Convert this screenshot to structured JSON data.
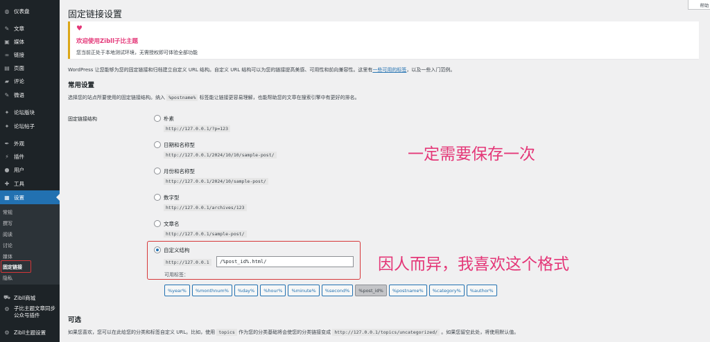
{
  "sidebar": {
    "dashboard": "仪表盘",
    "posts": "文章",
    "media": "媒体",
    "links": "链接",
    "pages": "页面",
    "comments": "评论",
    "tweets": "微语",
    "forum_board": "论坛版块",
    "forum_posts": "论坛帖子",
    "appearance": "外观",
    "plugins": "插件",
    "users": "用户",
    "tools": "工具",
    "settings": "设置",
    "submenu": [
      "常规",
      "撰写",
      "阅读",
      "讨论",
      "媒体",
      "固定链接",
      "隐私"
    ],
    "zibll_mall": "Zibll商城",
    "sync_plugin": "子比主题文章同步公众号插件",
    "zibll_theme_settings": "Zibll主题设置"
  },
  "help_button": "帮助",
  "page_title": "固定链接设置",
  "notice": {
    "title": "欢迎使用Zibll子比主题",
    "text": "您当前正处于本地测试环境，无需授权即可体验全部功能"
  },
  "intro": {
    "text_before": "WordPress 让您能够为您的固定链接和归档建立自定义 URL 结构。自定义 URL 结构可以为您的链接提高美感、可用性和前向兼容性。这里有",
    "link": "一些可用的标签",
    "text_after": "，以及一些入门范例。"
  },
  "common": {
    "heading": "常用设置",
    "desc_before": "选择您的站点所要使用的固定链接结构。纳入",
    "desc_code": "%postname%",
    "desc_after": "标签能让链接更容易理解，也能帮助您的文章在搜索引擎中有更好的排名。"
  },
  "permalink_label": "固定链接结构",
  "options": [
    {
      "label": "朴素",
      "example": "http://127.0.0.1/?p=123",
      "checked": false
    },
    {
      "label": "日期和名称型",
      "example": "http://127.0.0.1/2024/10/10/sample-post/",
      "checked": false
    },
    {
      "label": "月份和名称型",
      "example": "http://127.0.0.1/2024/10/sample-post/",
      "checked": false
    },
    {
      "label": "数字型",
      "example": "http://127.0.0.1/archives/123",
      "checked": false
    },
    {
      "label": "文章名",
      "example": "http://127.0.0.1/sample-post/",
      "checked": false
    },
    {
      "label": "自定义结构",
      "prefix": "http://127.0.0.1",
      "value": "/%post_id%.html/",
      "checked": true
    }
  ],
  "available_tags_label": "可用标签：",
  "tags": [
    "%year%",
    "%monthnum%",
    "%day%",
    "%hour%",
    "%minute%",
    "%second%",
    "%post_id%",
    "%postname%",
    "%category%",
    "%author%"
  ],
  "pressed_tag": "%post_id%",
  "annotations": {
    "save_once": "一定需要保存一次",
    "preference": "因人而异，我喜欢这个格式"
  },
  "optional": {
    "heading": "可选",
    "desc_before": "如果您喜欢，您可以在此给您的分类和标签自定义 URL。比如，使用",
    "desc_code1": "topics",
    "desc_mid": "作为您的分类基础将会使您的分类链接变成",
    "desc_code2": "http://127.0.0.1/topics/uncategorized/",
    "desc_after": "。如果您留空此处，将使用默认值。"
  },
  "colors": {
    "sidebar_bg": "#1d2327",
    "active_menu": "#2271b1",
    "annotation": "#e43778",
    "notice_border": "#dba617"
  }
}
